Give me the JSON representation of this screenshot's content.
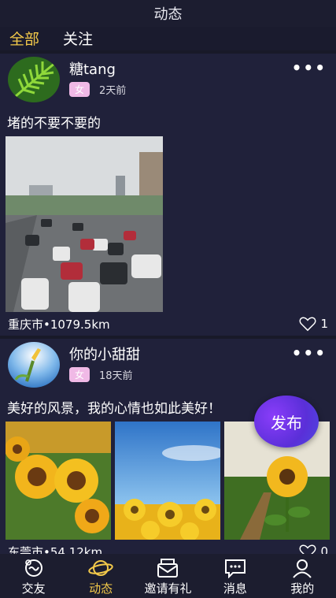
{
  "header": {
    "title": "动态"
  },
  "tabs": [
    {
      "label": "全部",
      "active": true
    },
    {
      "label": "关注",
      "active": false
    }
  ],
  "posts": [
    {
      "username": "糖tang",
      "gender": "女",
      "time": "2天前",
      "text": "堵的不要不要的",
      "location": "重庆市•1079.5km",
      "likes": "1",
      "images": [
        "city-traffic-photo"
      ]
    },
    {
      "username": "你的小甜甜",
      "gender": "女",
      "time": "18天前",
      "text": "美好的风景，我的心情也如此美好！",
      "location": "东莞市•54.12km",
      "likes": "0",
      "images": [
        "sunflowers-photo",
        "sunflower-field-sky-photo",
        "sunflower-path-photo"
      ]
    }
  ],
  "fab": {
    "label": "发布"
  },
  "bottom_nav": [
    {
      "label": "交友",
      "icon": "friends-icon",
      "active": false
    },
    {
      "label": "动态",
      "icon": "planet-icon",
      "active": true
    },
    {
      "label": "邀请有礼",
      "icon": "invite-envelope-icon",
      "active": false
    },
    {
      "label": "消息",
      "icon": "message-icon",
      "active": false
    },
    {
      "label": "我的",
      "icon": "profile-icon",
      "active": false
    }
  ],
  "colors": {
    "accent": "#f3c94a",
    "background": "#1a1b2e",
    "card": "#20213a",
    "badge": "#f0b9e6"
  }
}
